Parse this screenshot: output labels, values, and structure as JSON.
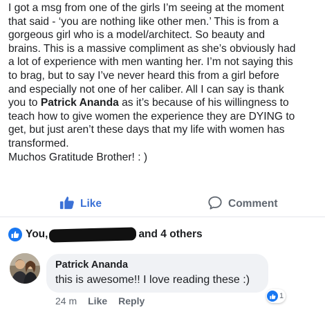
{
  "post": {
    "lines": [
      "I got a msg from one of the girls I’m seeing at the moment",
      "that said - ‘you are nothing like other men.’ This is from a",
      "gorgeous girl who is a model/architect. So beauty and",
      "brains. This is a massive compliment as she’s obviously had",
      "a lot of experience with men wanting her. I’m not saying this",
      "to brag, but to say I’ve never heard this from a girl before",
      "and especially not one of her caliber. All I can say is thank"
    ],
    "line8_before": "you to ",
    "line8_bold": "Patrick Ananda",
    "line8_after": " as it’s because of his willingness to",
    "lines_end": [
      "teach how to give women the experience they are DYING to",
      "get, but just aren’t these days that my life with women has",
      "transformed.",
      "Muchos Gratitude Brother! : )"
    ]
  },
  "actions": {
    "like_label": "Like",
    "comment_label": "Comment"
  },
  "reactions": {
    "prefix": "You,",
    "suffix": "and 4 others",
    "icon": "thumbs-up-icon"
  },
  "comment": {
    "author": "Patrick Ananda",
    "text": "this is awesome!! I love reading these :)",
    "time": "24 m",
    "like_label": "Like",
    "reply_label": "Reply",
    "reaction_count": "1"
  },
  "colors": {
    "accent": "#3b71d6",
    "reaction_blue": "#1877f2",
    "muted": "#606770",
    "bubble": "#f0f2f5"
  }
}
